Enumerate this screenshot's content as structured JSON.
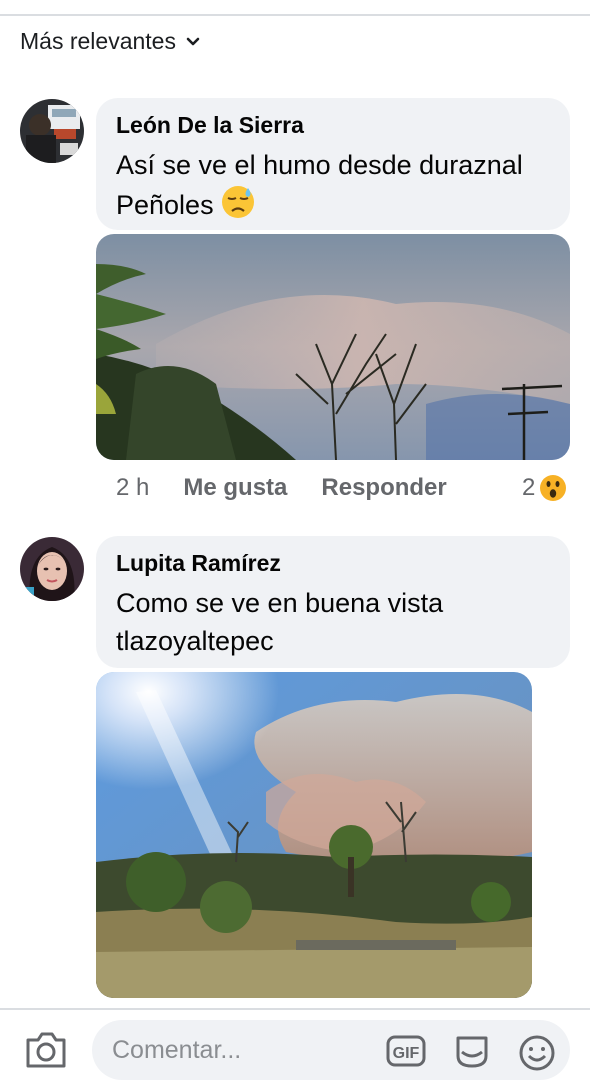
{
  "sort": {
    "label": "Más relevantes",
    "icon": "chevron-down-icon"
  },
  "comments": [
    {
      "author": "León De la Sierra",
      "text": "Así se ve el humo desde duraznal Peñoles",
      "emoji": "downcast-sweat-face-emoji",
      "time": "2 h",
      "like_label": "Me gusta",
      "reply_label": "Responder",
      "reaction_count": "2",
      "reaction_icon": "wow-reaction-icon"
    },
    {
      "author": "Lupita Ramírez",
      "text": "Como se ve en buena vista tlazoyaltepec"
    }
  ],
  "composer": {
    "placeholder": "Comentar...",
    "camera_icon": "camera-icon",
    "gif_label": "GIF",
    "sticker_icon": "sticker-icon",
    "emoji_icon": "smiley-icon"
  }
}
